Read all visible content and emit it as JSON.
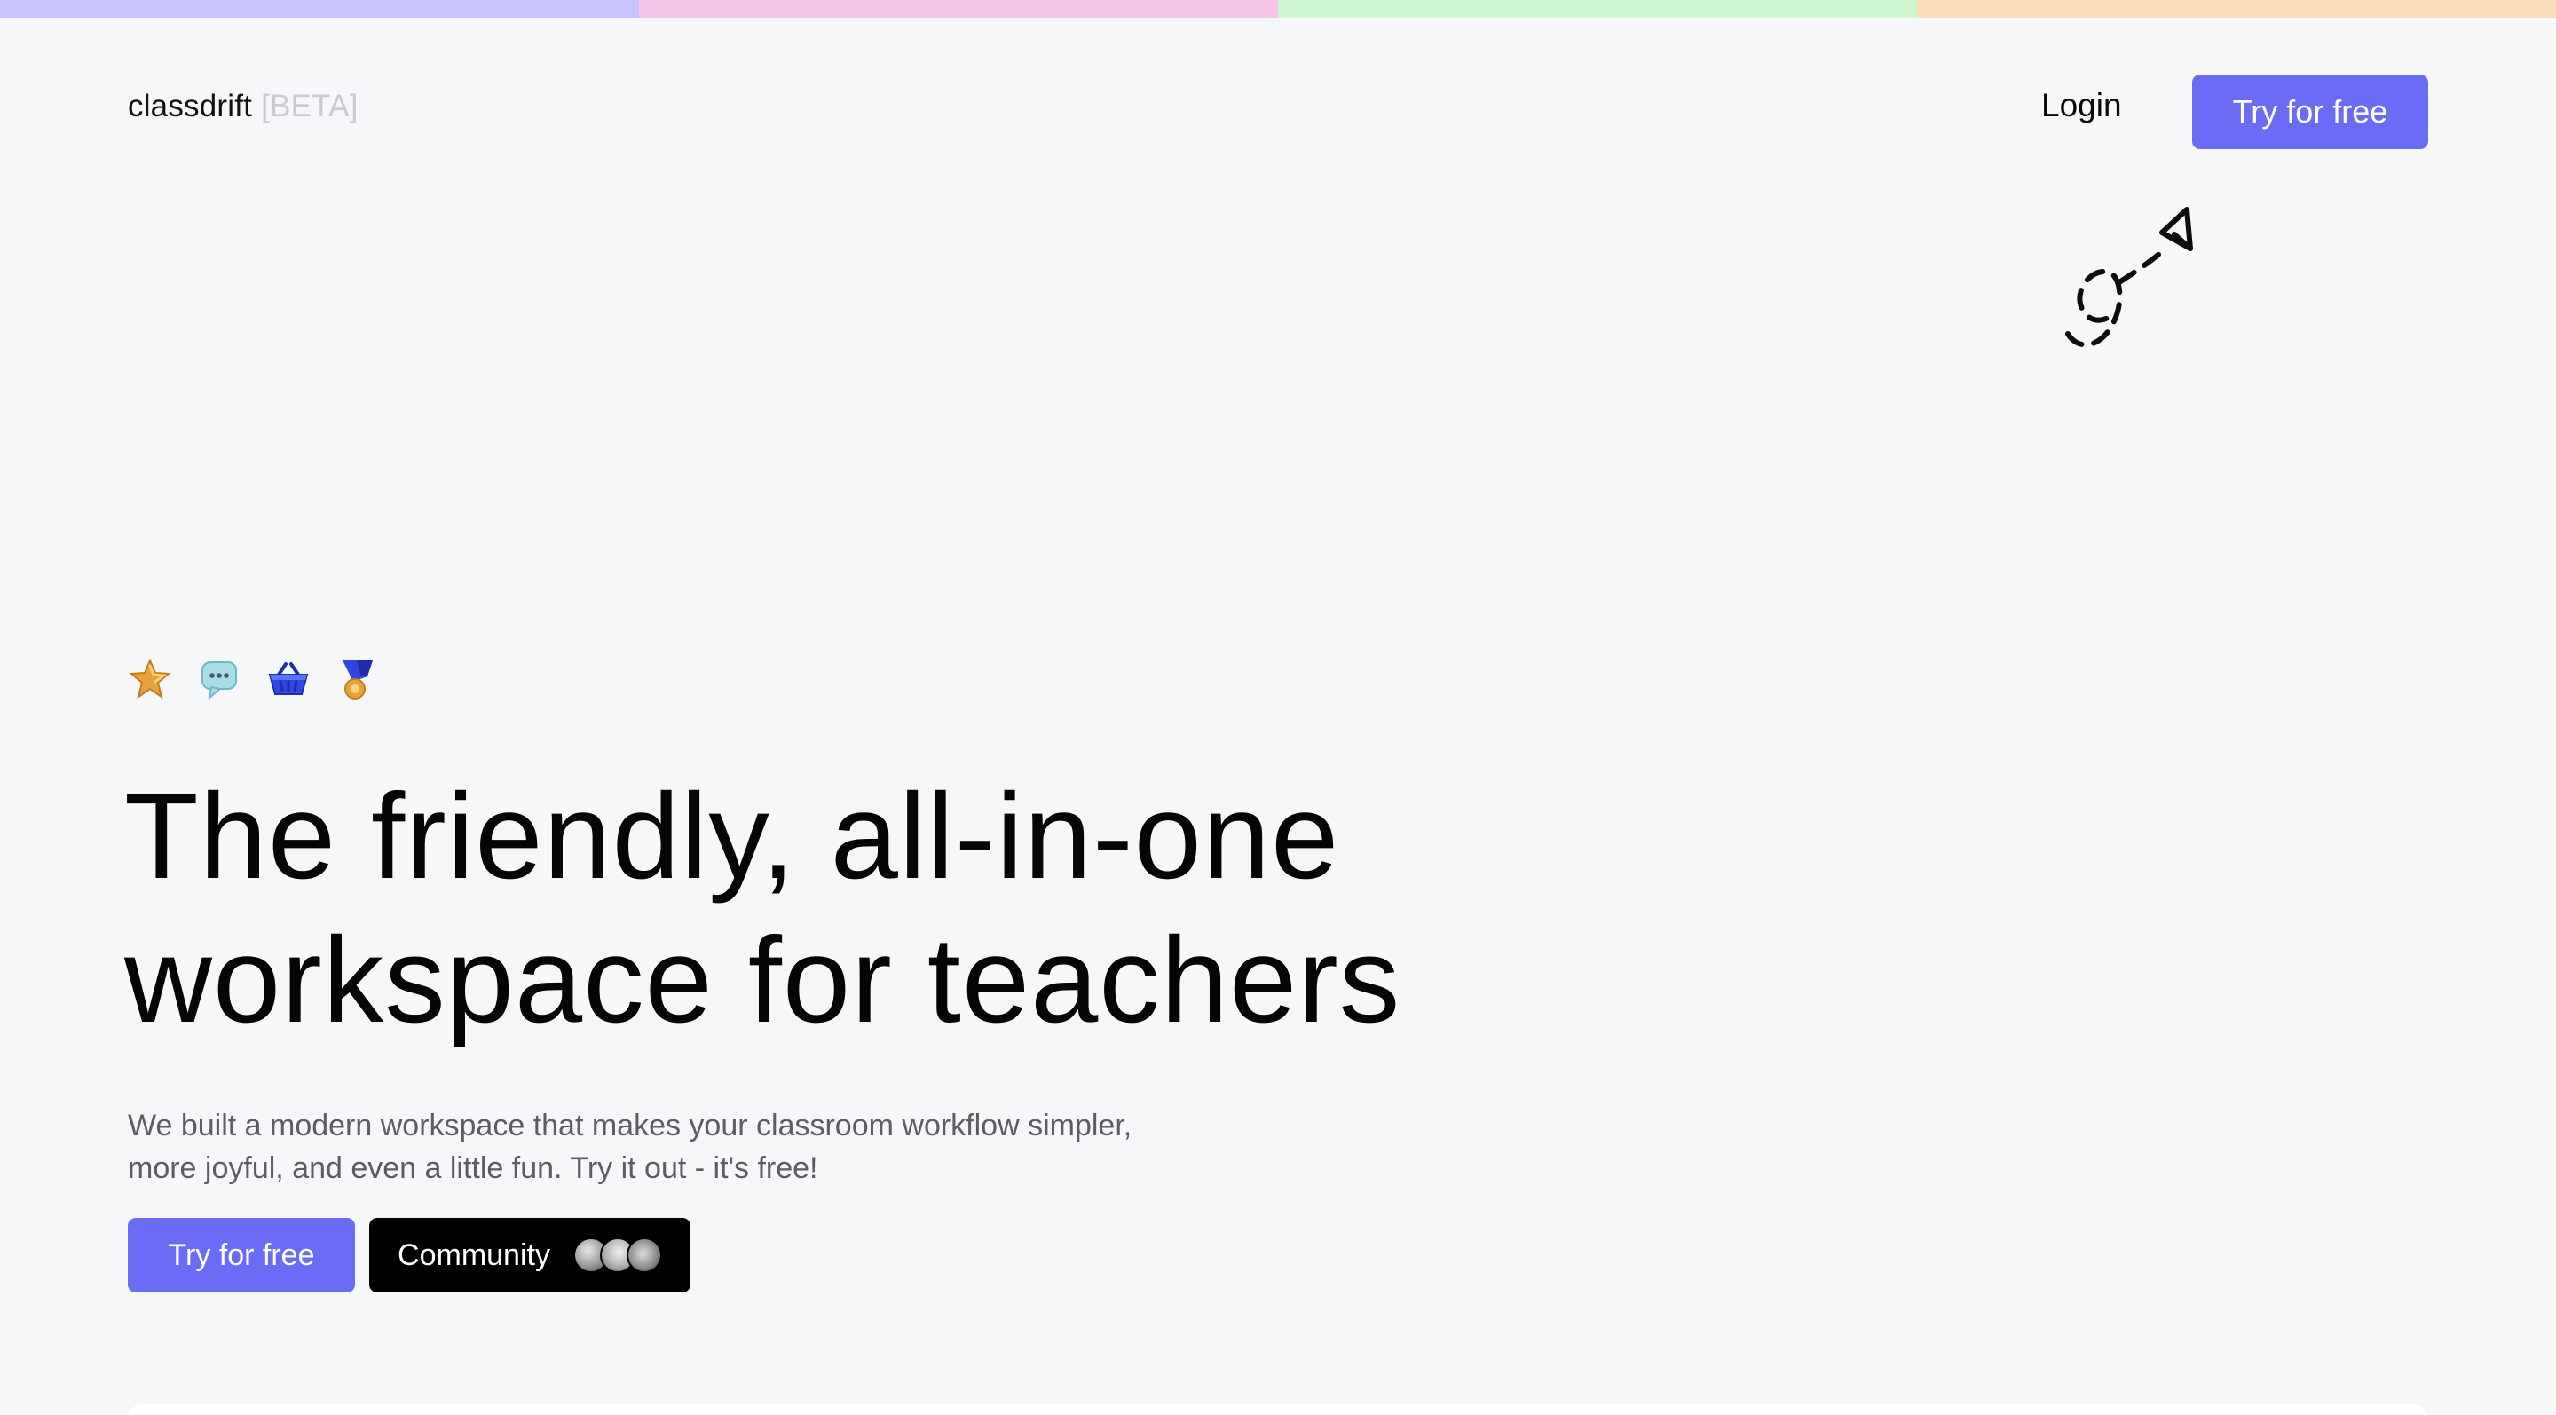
{
  "theme": {
    "stripe_colors": [
      "#c7c4fb",
      "#f6c6e8",
      "#cef7cf",
      "#fbdcbb"
    ],
    "accent": "#6a6cf6"
  },
  "header": {
    "logo_name": "classdrift",
    "logo_tag": "[BETA]",
    "login_label": "Login",
    "cta_label": "Try for free"
  },
  "hero": {
    "icons": [
      "star-icon",
      "chat-bubble-icon",
      "basket-icon",
      "medal-icon"
    ],
    "headline_lines": [
      "The friendly, all-in-one",
      "workspace for teachers"
    ],
    "subtitle_lines": [
      "We built a modern workspace that makes your classroom workflow simpler,",
      "more joyful, and even a little fun. Try it out - it's free!"
    ],
    "primary_cta": "Try for free",
    "community_cta": "Community"
  }
}
